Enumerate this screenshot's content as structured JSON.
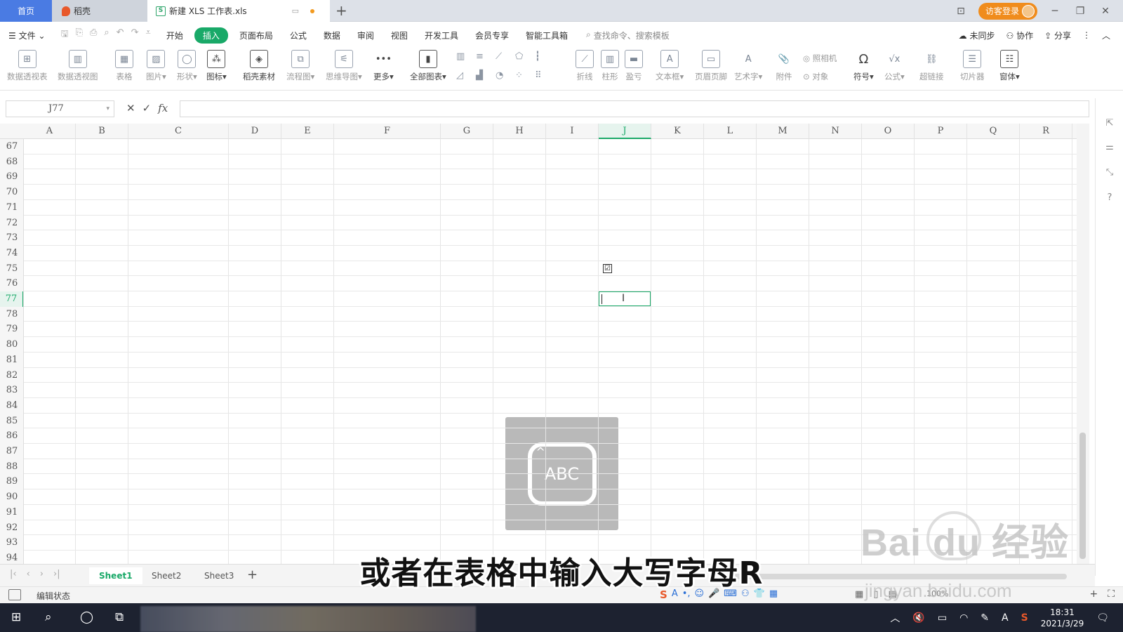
{
  "tabs": {
    "home": "首页",
    "daoke": "稻壳",
    "file": "新建 XLS 工作表.xls",
    "doc_icon": "S",
    "new_tab": "+"
  },
  "titlebar": {
    "login": "访客登录",
    "win_icon": "⊡",
    "minimize": "─",
    "restore": "❐",
    "close": "✕"
  },
  "menu": {
    "file": "文件",
    "items": [
      "开始",
      "插入",
      "页面布局",
      "公式",
      "数据",
      "审阅",
      "视图",
      "开发工具",
      "会员专享",
      "智能工具箱"
    ],
    "active": "插入",
    "search": "查找命令、搜索模板",
    "sync": "未同步",
    "collab": "协作",
    "share": "分享"
  },
  "ribbon": {
    "items": [
      "数据透视表",
      "数据透视图",
      "表格",
      "图片",
      "形状",
      "图标",
      "稻壳素材",
      "流程图",
      "思维导图",
      "更多",
      "全部图表",
      "折线",
      "柱形",
      "盈亏",
      "文本框",
      "页眉页脚",
      "艺术字",
      "附件",
      "照相机",
      "对象",
      "符号",
      "公式",
      "超链接",
      "切片器",
      "窗体"
    ]
  },
  "formula_bar": {
    "name_box": "J77",
    "cancel": "✕",
    "confirm": "✓",
    "fx": "fx",
    "value": ""
  },
  "sheet": {
    "columns": [
      "A",
      "B",
      "C",
      "D",
      "E",
      "F",
      "G",
      "H",
      "I",
      "J",
      "K",
      "L",
      "M",
      "N",
      "O",
      "P",
      "Q",
      "R"
    ],
    "selected_column": "J",
    "rows": [
      "67",
      "68",
      "69",
      "70",
      "71",
      "72",
      "73",
      "74",
      "75",
      "76",
      "77",
      "78",
      "79",
      "80",
      "81",
      "82",
      "83",
      "84",
      "85",
      "86",
      "87",
      "88",
      "89",
      "90",
      "91",
      "92",
      "93",
      "94"
    ],
    "selected_row": "77",
    "checkbox_mark": "☑",
    "ibeam": "I"
  },
  "ime_popup": {
    "label": "ABC",
    "caret": "^"
  },
  "sheet_tabs": {
    "items": [
      "Sheet1",
      "Sheet2",
      "Sheet3"
    ],
    "active": "Sheet1",
    "add": "+"
  },
  "status": {
    "mode": "编辑状态",
    "zoom": "100%"
  },
  "taskbar": {
    "time": "18:31",
    "date": "2021/3/29",
    "ime_letter": "A"
  },
  "subtitle": "或者在表格中输入大写字母R",
  "watermark": {
    "brand": "Bai  du 经验",
    "url": "jingyan.baidu.com"
  },
  "colors": {
    "accent": "#19a968",
    "home_tab": "#4a7be3",
    "login": "#f08c1c"
  }
}
